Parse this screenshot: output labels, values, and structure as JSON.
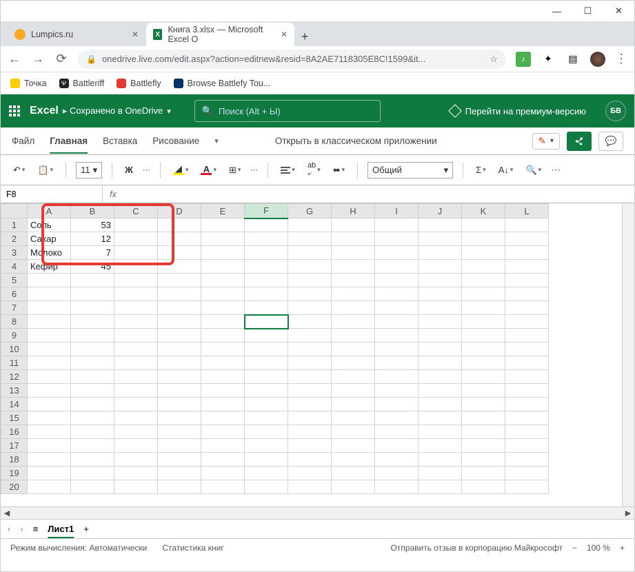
{
  "chrome": {
    "tabs": [
      {
        "title": "Lumpics.ru"
      },
      {
        "title": "Книга 3.xlsx — Microsoft Excel O"
      }
    ],
    "url": "onedrive.live.com/edit.aspx?action=editnew&resid=8A2AE7118305E8C!1599&it...",
    "bookmarks": [
      {
        "label": "Точка"
      },
      {
        "label": "Battleriff"
      },
      {
        "label": "Battlefly"
      },
      {
        "label": "Browse Battlefy Tou..."
      }
    ]
  },
  "excel": {
    "app_name": "Excel",
    "saved_text": "Сохранено в OneDrive",
    "search_placeholder": "Поиск (Alt + Ы)",
    "premium_text": "Перейти на премиум-версию",
    "avatar": "БВ",
    "ribbon_tabs": {
      "file": "Файл",
      "home": "Главная",
      "insert": "Вставка",
      "draw": "Рисование"
    },
    "open_desktop": "Открыть в классическом приложении",
    "toolbar": {
      "font_size": "11",
      "bold": "Ж",
      "number_format": "Общий"
    },
    "name_box": "F8",
    "columns": [
      "A",
      "B",
      "C",
      "D",
      "E",
      "F",
      "G",
      "H",
      "I",
      "J",
      "K",
      "L"
    ],
    "rows": [
      {
        "r": 1,
        "A": "Соль",
        "B": "53"
      },
      {
        "r": 2,
        "A": "Сахар",
        "B": "12"
      },
      {
        "r": 3,
        "A": "Молоко",
        "B": "7"
      },
      {
        "r": 4,
        "A": "Кефир",
        "B": "45"
      },
      {
        "r": 5
      },
      {
        "r": 6
      },
      {
        "r": 7
      },
      {
        "r": 8
      },
      {
        "r": 9
      },
      {
        "r": 10
      },
      {
        "r": 11
      },
      {
        "r": 12
      },
      {
        "r": 13
      },
      {
        "r": 14
      },
      {
        "r": 15
      },
      {
        "r": 16
      },
      {
        "r": 17
      },
      {
        "r": 18
      },
      {
        "r": 19
      },
      {
        "r": 20
      }
    ],
    "active_cell": {
      "row": 8,
      "col": "F"
    },
    "sheet_tab": "Лист1",
    "status_calc": "Режим вычисления: Автоматически",
    "status_stats": "Статистика книг",
    "feedback": "Отправить отзыв в корпорацию Майкрософт",
    "zoom_minus": "−",
    "zoom_pct": "100 %",
    "zoom_plus": "+"
  }
}
